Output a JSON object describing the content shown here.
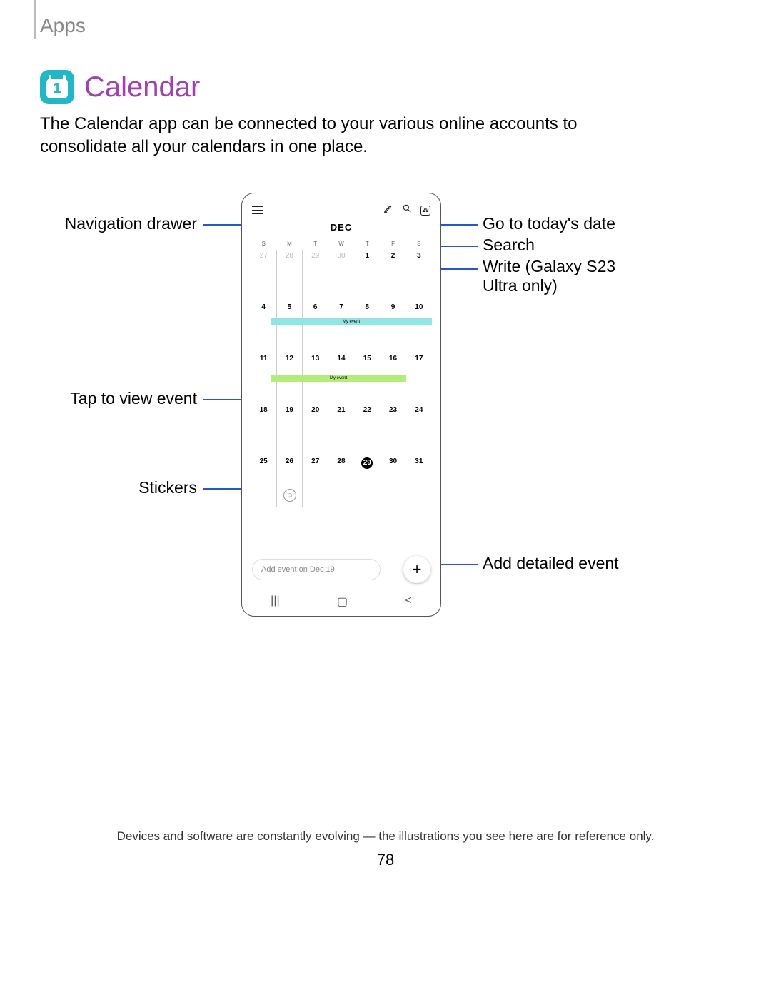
{
  "breadcrumb": "Apps",
  "title": "Calendar",
  "intro": "The Calendar app can be connected to your various online accounts to consolidate all your calendars in one place.",
  "callouts": {
    "nav_drawer": "Navigation drawer",
    "tap_event": "Tap to view event",
    "stickers": "Stickers",
    "today": "Go to today's date",
    "search": "Search",
    "write": "Write (Galaxy S23 Ultra only)",
    "add_detailed": "Add detailed event"
  },
  "phone": {
    "month": "DEC",
    "today_badge": "29",
    "dow": [
      "S",
      "M",
      "T",
      "W",
      "T",
      "F",
      "S"
    ],
    "weeks": [
      [
        "27",
        "28",
        "29",
        "30",
        "1",
        "2",
        "3"
      ],
      [
        "4",
        "5",
        "6",
        "7",
        "8",
        "9",
        "10"
      ],
      [
        "11",
        "12",
        "13",
        "14",
        "15",
        "16",
        "17"
      ],
      [
        "18",
        "19",
        "20",
        "21",
        "22",
        "23",
        "24"
      ],
      [
        "25",
        "26",
        "27",
        "28",
        "29",
        "30",
        "31"
      ]
    ],
    "prev_month_cells": 4,
    "today_date": "29",
    "selected_col": 1,
    "event1_label": "My event",
    "event2_label": "My event",
    "quick_add": "Add event on Dec 19",
    "sticker_face": "☺"
  },
  "footnote": "Devices and software are constantly evolving — the illustrations you see here are for reference only.",
  "page_number": "78"
}
